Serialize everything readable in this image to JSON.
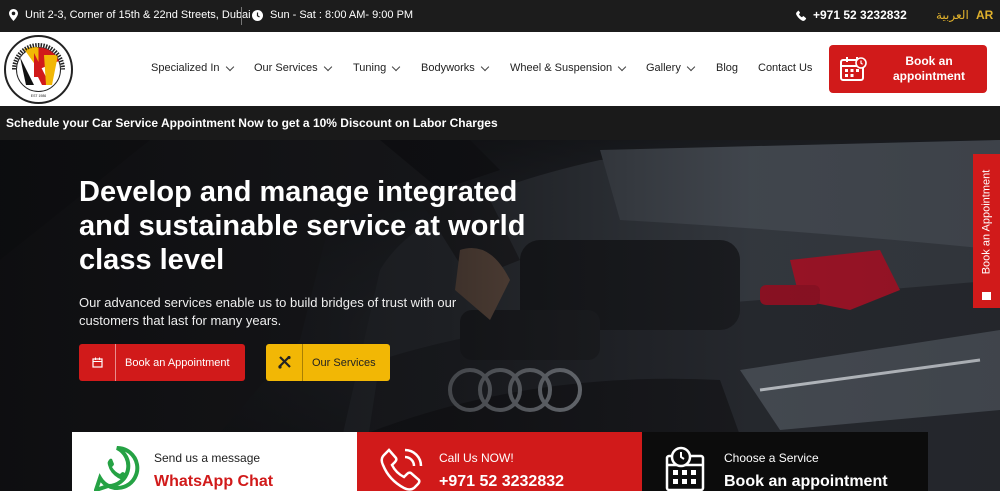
{
  "topbar": {
    "address": "Unit 2-3, Corner of 15th & 22nd Streets, Dubai",
    "hours": "Sun - Sat : 8:00 AM- 9:00 PM",
    "phone": "+971 52 3232832",
    "arabic_label": "العربية",
    "ar_label": "AR"
  },
  "logo": {
    "ring_text": "DEUTSCHES AUTO SERVICE CENTER",
    "est": "EST 1986"
  },
  "nav": {
    "items": [
      {
        "label": "Specialized In",
        "dropdown": true
      },
      {
        "label": "Our Services",
        "dropdown": true
      },
      {
        "label": "Tuning",
        "dropdown": true
      },
      {
        "label": "Bodyworks",
        "dropdown": true
      },
      {
        "label": "Wheel & Suspension",
        "dropdown": true
      },
      {
        "label": "Gallery",
        "dropdown": true
      },
      {
        "label": "Blog",
        "dropdown": false
      },
      {
        "label": "Contact Us",
        "dropdown": false
      }
    ],
    "book_line1": "Book an",
    "book_line2": "appointment"
  },
  "promo": {
    "text": "Schedule your Car Service Appointment Now to get a 10% Discount on Labor Charges"
  },
  "hero": {
    "headline": "Develop and manage integrated and sustainable service at world class level",
    "subtext": "Our advanced services enable us to build bridges of trust with our customers that last for many years.",
    "book_button": "Book an Appointment",
    "services_button": "Our Services",
    "side_tab": "Book an Appointment"
  },
  "cards": {
    "whatsapp_small": "Send us a message",
    "whatsapp_big": "WhatsApp Chat",
    "call_small": "Call Us NOW!",
    "call_big": "+971 52 3232832",
    "service_small": "Choose a Service",
    "service_big": "Book an appointment"
  },
  "colors": {
    "brand_red": "#d11a1a",
    "accent_yellow": "#f2b705",
    "dark": "#1c1c1c"
  }
}
